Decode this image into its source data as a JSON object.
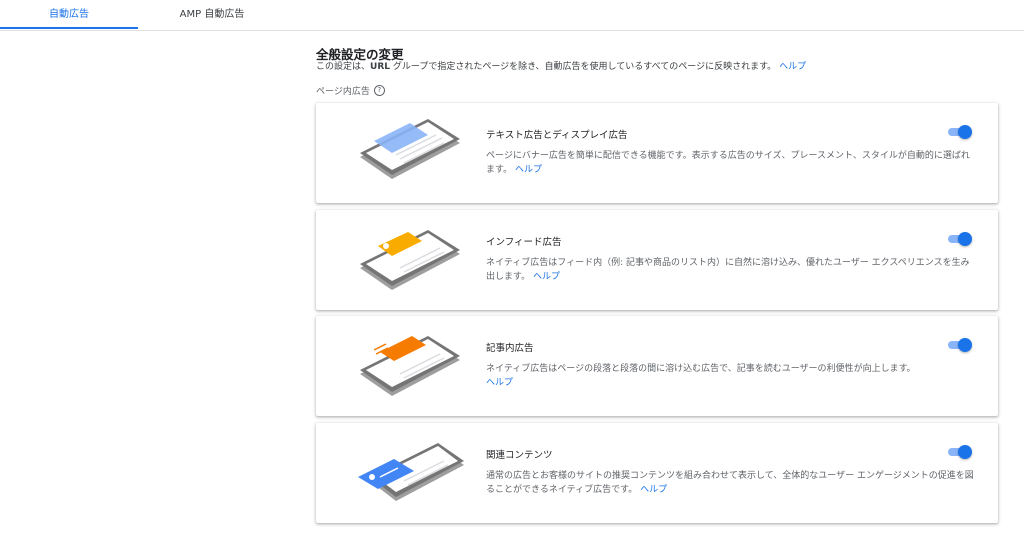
{
  "tabs": [
    {
      "label": "自動広告",
      "active": true
    },
    {
      "label": "AMP 自動広告",
      "active": false
    }
  ],
  "section": {
    "title": "全般設定の変更",
    "desc_before": "この設定は、",
    "desc_bold": "URL",
    "desc_after": " グループで指定されたページを除き、自動広告を使用しているすべてのページに反映されます。",
    "help_link": "ヘルプ",
    "inpage_label": "ページ内広告"
  },
  "cards": [
    {
      "title": "テキスト広告とディスプレイ広告",
      "desc": "ページにバナー広告を簡単に配信できる機能です。表示する広告のサイズ、プレースメント、スタイルが自動的に選ばれます。",
      "help": "ヘルプ",
      "enabled": true,
      "accent": "#8ab4f8"
    },
    {
      "title": "インフィード広告",
      "desc": "ネイティブ広告はフィード内（例: 記事や商品のリスト内）に自然に溶け込み、優れたユーザー エクスペリエンスを生み出します。",
      "help": "ヘルプ",
      "enabled": true,
      "accent": "#f9ab00"
    },
    {
      "title": "記事内広告",
      "desc": "ネイティブ広告はページの段落と段落の間に溶け込む広告で、記事を読むユーザーの利便性が向上します。",
      "help": "ヘルプ",
      "enabled": true,
      "accent": "#f57c00"
    },
    {
      "title": "関連コンテンツ",
      "desc": "通常の広告とお客様のサイトの推奨コンテンツを組み合わせて表示して、全体的なユーザー エンゲージメントの促進を図ることができるネイティブ広告です。",
      "help": "ヘルプ",
      "enabled": true,
      "accent": "#4285f4"
    }
  ]
}
